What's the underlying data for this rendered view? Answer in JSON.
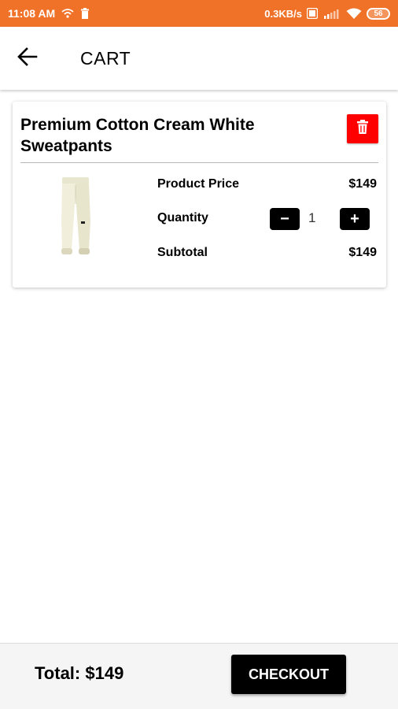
{
  "status_bar": {
    "time": "11:08 AM",
    "network_speed": "0.3KB/s",
    "battery": "56",
    "background_color": "#f07228",
    "icons": [
      "wifi-call-icon",
      "trash-icon",
      "data-saver-icon",
      "signal-icon",
      "wifi-icon",
      "battery-icon"
    ]
  },
  "app_bar": {
    "title": "CART",
    "back_icon": "arrow-left-icon"
  },
  "cart_item": {
    "name": "Premium Cotton Cream White Sweatpants",
    "price_label": "Product Price",
    "price": "$149",
    "quantity_label": "Quantity",
    "quantity": "1",
    "decrement_label": "−",
    "increment_label": "+",
    "subtotal_label": "Subtotal",
    "subtotal": "$149",
    "delete_icon": "trash-icon",
    "delete_color": "#ff0000"
  },
  "footer": {
    "total": "Total: $149",
    "checkout_label": "CHECKOUT"
  }
}
